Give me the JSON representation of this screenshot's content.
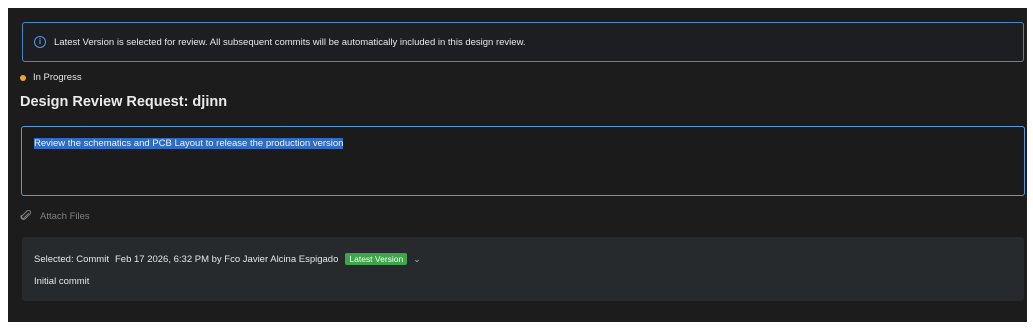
{
  "banner": {
    "icon": "info-icon",
    "text": "Latest Version is selected for review. All subsequent commits will be automatically included in this design review."
  },
  "status": {
    "label": "In Progress",
    "color": "#f0a430"
  },
  "title": "Design Review Request: djinn",
  "description": {
    "value": "Review the schematics and PCB Layout to release the production version"
  },
  "attach": {
    "icon": "paperclip-icon",
    "label": "Attach Files"
  },
  "commit": {
    "selected_label": "Selected: Commit",
    "details": "Feb 17 2026, 6:32 PM by Fco Javier Alcina Espigado",
    "badge": "Latest Version",
    "badge_color": "#3fa54a",
    "message": "Initial commit"
  },
  "colors": {
    "accent": "#4b86c4",
    "background": "#1c1c1c"
  }
}
